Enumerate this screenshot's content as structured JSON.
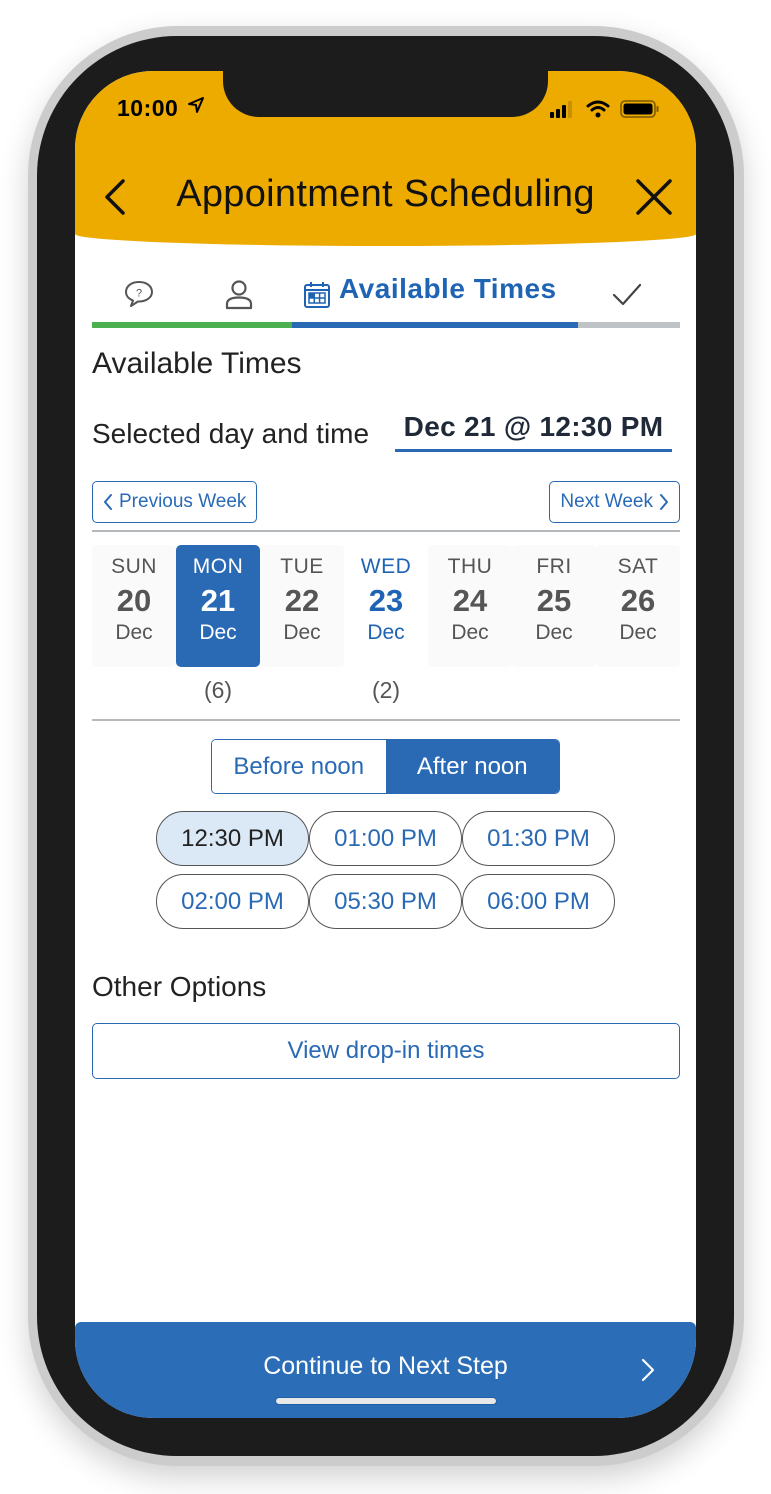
{
  "status_bar": {
    "time": "10:00"
  },
  "header": {
    "title": "Appointment Scheduling"
  },
  "steps": {
    "items": [
      {
        "icon": "question-bubble-icon",
        "state": "done"
      },
      {
        "icon": "person-icon",
        "state": "done"
      },
      {
        "icon": "calendar-icon",
        "label": "Available Times",
        "state": "active"
      },
      {
        "icon": "checkmark-icon",
        "state": "todo"
      }
    ]
  },
  "main": {
    "title": "Available Times",
    "selected_label": "Selected day and time",
    "selected_value": "Dec 21 @ 12:30 PM",
    "prev_week": "Previous Week",
    "next_week": "Next Week",
    "days": [
      {
        "name": "SUN",
        "num": "20",
        "month": "Dec",
        "count": ""
      },
      {
        "name": "MON",
        "num": "21",
        "month": "Dec",
        "count": "(6)",
        "selected": true
      },
      {
        "name": "TUE",
        "num": "22",
        "month": "Dec",
        "count": ""
      },
      {
        "name": "WED",
        "num": "23",
        "month": "Dec",
        "count": "(2)"
      },
      {
        "name": "THU",
        "num": "24",
        "month": "Dec",
        "count": ""
      },
      {
        "name": "FRI",
        "num": "25",
        "month": "Dec",
        "count": ""
      },
      {
        "name": "SAT",
        "num": "26",
        "month": "Dec",
        "count": ""
      }
    ],
    "period_toggle": {
      "before": "Before noon",
      "after": "After noon",
      "selected": "after"
    },
    "slots": [
      "12:30 PM",
      "01:00 PM",
      "01:30 PM",
      "02:00 PM",
      "05:30 PM",
      "06:00 PM"
    ],
    "selected_slot": "12:30 PM",
    "other_title": "Other Options",
    "dropin": "View drop-in times"
  },
  "footer": {
    "continue": "Continue to Next Step"
  },
  "colors": {
    "header": "#edab00",
    "primary": "#2a6ab5",
    "done": "#4caf50",
    "todo": "#bfc3c7"
  }
}
